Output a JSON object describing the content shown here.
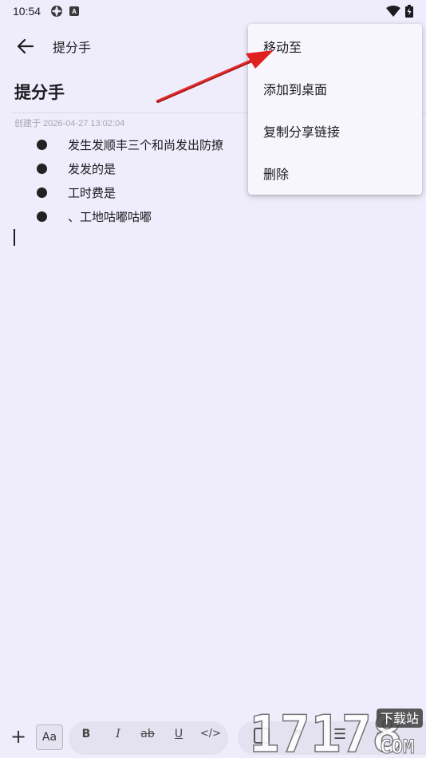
{
  "status_bar": {
    "time": "10:54",
    "badge": "A"
  },
  "app_bar": {
    "title": "提分手"
  },
  "note": {
    "title": "提分手",
    "created": "创建于 2026-04-27 13:02:04",
    "bullets": [
      "发生发顺丰三个和尚发出防撩",
      "发发的是",
      "工时费是",
      "、工地咕嘟咕嘟"
    ]
  },
  "menu": {
    "items": [
      "移动至",
      "添加到桌面",
      "复制分享链接",
      "删除"
    ]
  },
  "toolbar": {
    "plus": "+",
    "aa": "Aa",
    "bold": "B",
    "italic": "I",
    "strike": "ab",
    "underline": "U",
    "code": "</>"
  },
  "watermark": {
    "text": "17178",
    "tag": "下载站",
    "suffix": "COM"
  },
  "colors": {
    "background": "#efecfb",
    "menu": "#f7f5fd",
    "arrow": "#e02020"
  },
  "icons": [
    "back-arrow-icon",
    "wifi-icon",
    "battery-icon",
    "gear-icon"
  ]
}
